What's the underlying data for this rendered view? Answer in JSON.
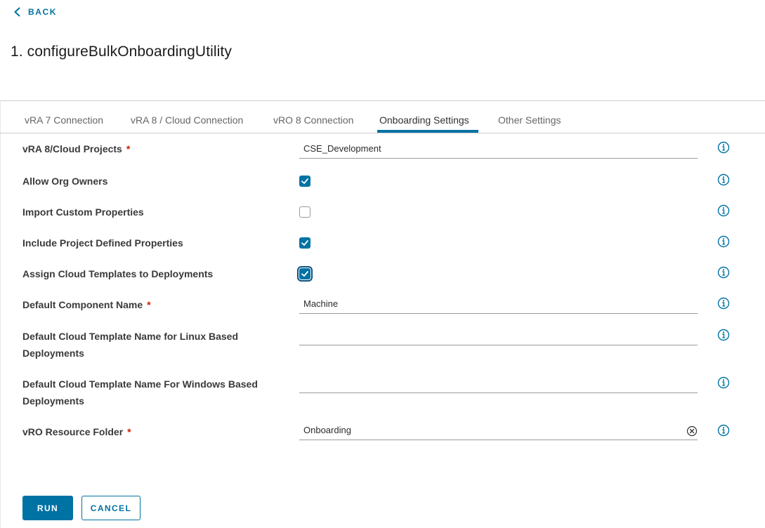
{
  "header": {
    "back_label": "BACK",
    "title": "1. configureBulkOnboardingUtility"
  },
  "tabs": [
    {
      "label": "vRA 7 Connection",
      "active": false
    },
    {
      "label": "vRA 8 / Cloud Connection",
      "active": false
    },
    {
      "label": "vRO 8 Connection",
      "active": false
    },
    {
      "label": "Onboarding Settings",
      "active": true
    },
    {
      "label": "Other Settings",
      "active": false
    }
  ],
  "form": {
    "cloud_projects": {
      "label": "vRA 8/Cloud Projects",
      "required": "*",
      "value": "CSE_Development"
    },
    "allow_org_owners": {
      "label": "Allow Org Owners",
      "checked": true
    },
    "import_custom_properties": {
      "label": "Import Custom Properties",
      "checked": false
    },
    "include_project_properties": {
      "label": "Include Project Defined Properties",
      "checked": true
    },
    "assign_cloud_templates": {
      "label": "Assign Cloud Templates to Deployments",
      "checked": true
    },
    "default_component_name": {
      "label": "Default Component Name",
      "required": "*",
      "value": "Machine"
    },
    "linux_template": {
      "label_line1": "Default Cloud Template Name for Linux Based",
      "label_line2": "Deployments",
      "value": ""
    },
    "windows_template": {
      "label_line1": "Default Cloud Template Name For Windows Based",
      "label_line2": "Deployments",
      "value": ""
    },
    "resource_folder": {
      "label": "vRO Resource Folder",
      "required": "*",
      "value": "Onboarding"
    }
  },
  "actions": {
    "run_label": "RUN",
    "cancel_label": "CANCEL"
  },
  "colors": {
    "accent": "#0072a3",
    "required": "#c92100"
  }
}
